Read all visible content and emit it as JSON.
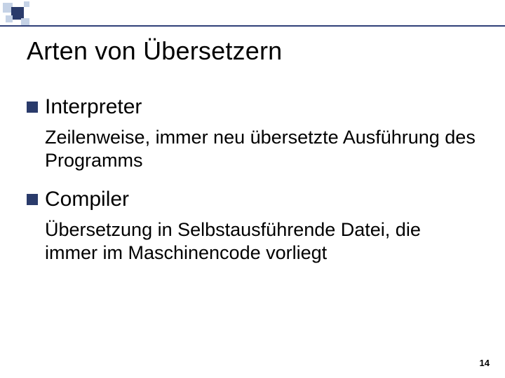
{
  "title": "Arten von Übersetzern",
  "items": [
    {
      "heading": "Interpreter",
      "body": "Zeilenweise, immer neu übersetzte Ausführung des Programms"
    },
    {
      "heading": "Compiler",
      "body": "Übersetzung in Selbstausführende Datei, die immer im Maschinencode vorliegt"
    }
  ],
  "page_number": "14"
}
